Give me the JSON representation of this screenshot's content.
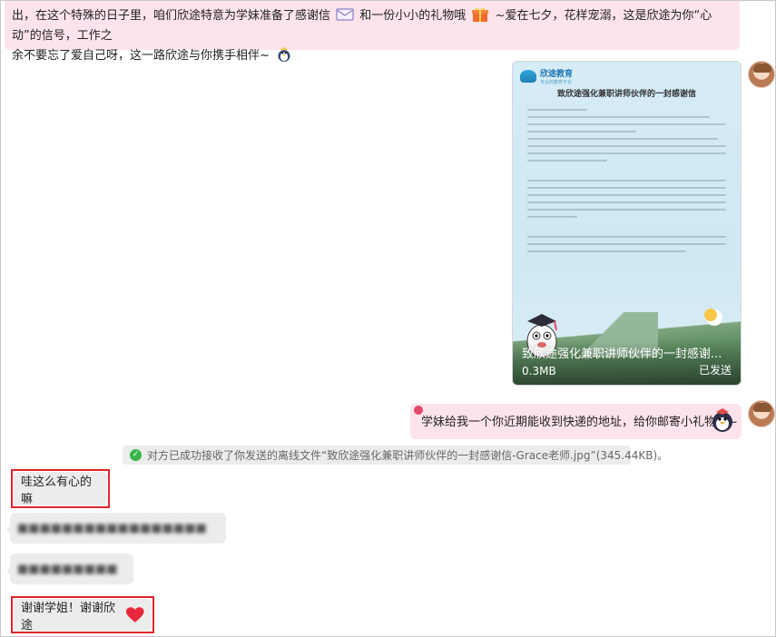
{
  "top_message": {
    "text_part1": "出，在这个特殊的日子里，咱们欣途特意为学妹准备了感谢信",
    "text_part2": "和一份小小的礼物哦",
    "text_part3": "~爱在七夕，花样宠溺，这是欣途为你“心动”的信号，工作之",
    "text_part4": "余不要忘了爱自己呀，这一路欣途与你携手相伴~",
    "icons": [
      "envelope-icon",
      "gift-icon",
      "penguin-icon"
    ]
  },
  "image_message": {
    "logo_name": "欣途教育",
    "logo_sub": "专业的教育平台",
    "letter_title": "致欣途强化兼职讲师伙伴的一封感谢信",
    "caption": "致欣途强化兼职讲师伙伴的一封感谢...",
    "file_size": "0.3MB",
    "status": "已发送"
  },
  "right_message": {
    "text": "学妹给我一个你近期能收到快递的地址，给你邮寄小礼物哦~",
    "icon": "penguin-icon"
  },
  "system_notice": {
    "text": "对方已成功接收了你发送的离线文件“致欣途强化兼职讲师伙伴的一封感谢信-Grace老师.jpg”(345.44KB)。"
  },
  "left_messages": [
    {
      "text": "哇这么有心的嘛",
      "highlighted": true
    },
    {
      "text": "■■■■■■■■■■■■■■■■■",
      "blurred": true
    },
    {
      "text": "■■■■■■■■■",
      "blurred": true
    },
    {
      "text": "谢谢学姐！谢谢欣途",
      "highlighted": true,
      "icon": "heart-icon"
    }
  ],
  "colors": {
    "pink_bubble": "#fde3ea",
    "grey_bubble": "#ececec",
    "highlight_border": "#e0262a",
    "success_check": "#3ab54a"
  }
}
